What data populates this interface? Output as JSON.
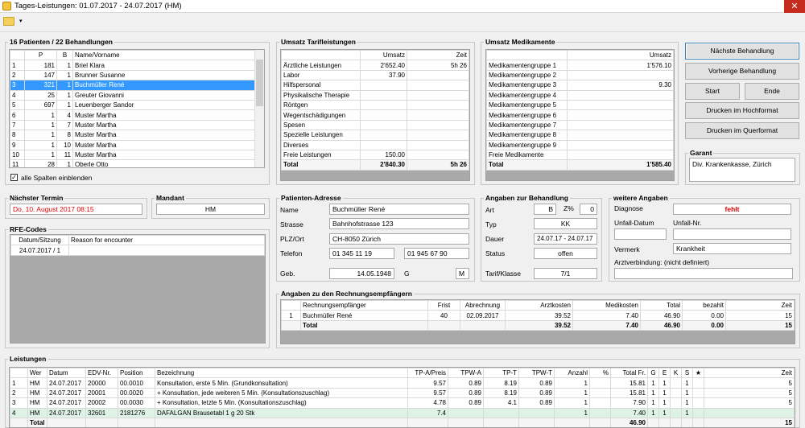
{
  "window": {
    "title": "Tages-Leistungen: 01.07.2017 - 24.07.2017 (HM)",
    "close": "✕"
  },
  "toolbar": {
    "dropdown": "▾"
  },
  "patients": {
    "title": "16 Patienten / 22 Behandlungen",
    "headers": [
      "",
      "P",
      "B",
      "Name/Vorname"
    ],
    "rows": [
      [
        "1",
        "181",
        "1",
        "Briel Klara"
      ],
      [
        "2",
        "147",
        "1",
        "Brunner Susanne"
      ],
      [
        "3",
        "321",
        "1",
        "Buchmüller René"
      ],
      [
        "4",
        "25",
        "1",
        "Greuter Giovanni"
      ],
      [
        "5",
        "697",
        "1",
        "Leuenberger Sandor"
      ],
      [
        "6",
        "1",
        "4",
        "Muster Martha"
      ],
      [
        "7",
        "1",
        "7",
        "Muster Martha"
      ],
      [
        "8",
        "1",
        "8",
        "Muster Martha"
      ],
      [
        "9",
        "1",
        "10",
        "Muster Martha"
      ],
      [
        "10",
        "1",
        "11",
        "Muster Martha"
      ],
      [
        "11",
        "28",
        "1",
        "Oberle Otto"
      ]
    ],
    "selected_index": 2,
    "show_all_label": "alle Spalten einblenden",
    "show_all_checked": "✓"
  },
  "umsatz_tarif": {
    "title": "Umsatz Tarifleistungen",
    "headers": [
      "",
      "Umsatz",
      "Zeit"
    ],
    "rows": [
      [
        "Ärztliche Leistungen",
        "2'652.40",
        "5h 26"
      ],
      [
        "Labor",
        "37.90",
        ""
      ],
      [
        "Hilfspersonal",
        "",
        ""
      ],
      [
        "Physikalische Therapie",
        "",
        ""
      ],
      [
        "Röntgen",
        "",
        ""
      ],
      [
        "Wegentschädigungen",
        "",
        ""
      ],
      [
        "Spesen",
        "",
        ""
      ],
      [
        "Spezielle Leistungen",
        "",
        ""
      ],
      [
        "Diverses",
        "",
        ""
      ],
      [
        "Freie Leistungen",
        "150.00",
        ""
      ]
    ],
    "total": [
      "Total",
      "2'840.30",
      "5h 26"
    ]
  },
  "umsatz_med": {
    "title": "Umsatz Medikamente",
    "headers": [
      "",
      "Umsatz"
    ],
    "rows": [
      [
        "Medikamentengruppe 1",
        "1'576.10"
      ],
      [
        "Medikamentengruppe 2",
        ""
      ],
      [
        "Medikamentengruppe 3",
        "9.30"
      ],
      [
        "Medikamentengruppe 4",
        ""
      ],
      [
        "Medikamentengruppe 5",
        ""
      ],
      [
        "Medikamentengruppe 6",
        ""
      ],
      [
        "Medikamentengruppe 7",
        ""
      ],
      [
        "Medikamentengruppe 8",
        ""
      ],
      [
        "Medikamentengruppe 9",
        ""
      ],
      [
        "Freie Medikamente",
        ""
      ]
    ],
    "total": [
      "Total",
      "1'585.40"
    ]
  },
  "buttons": {
    "next": "Nächste Behandlung",
    "prev": "Vorherige Behandlung",
    "start": "Start",
    "end": "Ende",
    "print_portrait": "Drucken im Hochformat",
    "print_landscape": "Drucken im Querformat"
  },
  "garant": {
    "title": "Garant",
    "value": "Div. Krankenkasse, Zürich"
  },
  "next_appointment": {
    "title": "Nächster Termin",
    "value": "Do, 10. August 2017 08:15"
  },
  "mandant": {
    "title": "Mandant",
    "value": "HM"
  },
  "rfe": {
    "title": "RFE-Codes",
    "headers": [
      "Datum/Sitzung",
      "Reason for encounter"
    ],
    "rows": [
      [
        "24.07.2017 / 1",
        ""
      ]
    ]
  },
  "address": {
    "title": "Patienten-Adresse",
    "name_label": "Name",
    "name": "Buchmüller René",
    "street_label": "Strasse",
    "street": "Bahnhofstrasse 123",
    "city_label": "PLZ/Ort",
    "city": "CH-8050 Zürich",
    "phone_label": "Telefon",
    "phone1": "01 345 11 19",
    "phone2": "01 945 67 90",
    "birth_label": "Geb.",
    "birth": "14.05.1948",
    "sex_label": "G",
    "sex": "M"
  },
  "treatment": {
    "title": "Angaben zur Behandlung",
    "art_label": "Art",
    "art": "B",
    "z_label": "Z%",
    "z": "0",
    "typ_label": "Typ",
    "typ": "KK",
    "dauer_label": "Dauer",
    "dauer": "24.07.17 - 24.07.17",
    "status_label": "Status",
    "status": "offen",
    "tarif_label": "Tarif/Klasse",
    "tarif": "7/1"
  },
  "further": {
    "title": "weitere Angaben",
    "diag_label": "Diagnose",
    "diag": "fehlt",
    "unfall_datum_label": "Unfall-Datum",
    "unfall_nr_label": "Unfall-Nr.",
    "vermerk_label": "Vermerk",
    "vermerk": "Krankheit",
    "arzt_label": "Arztverbindung: (nicht definiert)"
  },
  "recipients": {
    "title": "Angaben zu den Rechnungsempfängern",
    "headers": [
      "",
      "Rechnungsempfänger",
      "Frist",
      "Abrechnung",
      "Arztkosten",
      "Medikosten",
      "Total",
      "bezahlt",
      "Zeit"
    ],
    "rows": [
      [
        "1",
        "Buchmüller René",
        "40",
        "02.09.2017",
        "39.52",
        "7.40",
        "46.90",
        "0.00",
        "15"
      ]
    ],
    "total": [
      "",
      "Total",
      "",
      "",
      "39.52",
      "7.40",
      "46.90",
      "0.00",
      "15"
    ]
  },
  "services": {
    "title": "Leistungen",
    "headers": [
      "",
      "Wer",
      "Datum",
      "EDV-Nr.",
      "Position",
      "Bezeichnung",
      "TP-A/Preis",
      "TPW-A",
      "TP-T",
      "TPW-T",
      "Anzahl",
      "%",
      "Total Fr.",
      "G",
      "E",
      "K",
      "S",
      "★",
      "Zeit"
    ],
    "rows": [
      [
        "1",
        "HM",
        "24.07.2017",
        "20000",
        "00.0010",
        "Konsultation, erste 5 Min. (Grundkonsultation)",
        "9.57",
        "0.89",
        "8.19",
        "0.89",
        "1",
        "",
        "15.81",
        "1",
        "1",
        "",
        "1",
        "",
        "5"
      ],
      [
        "2",
        "HM",
        "24.07.2017",
        "20001",
        "00.0020",
        "+ Konsultation, jede weiteren 5 Min. (Konsultationszuschlag)",
        "9.57",
        "0.89",
        "8.19",
        "0.89",
        "1",
        "",
        "15.81",
        "1",
        "1",
        "",
        "1",
        "",
        "5"
      ],
      [
        "3",
        "HM",
        "24.07.2017",
        "20002",
        "00.0030",
        "+ Konsultation, letzte 5 Min. (Konsultationszuschlag)",
        "4.78",
        "0.89",
        "4.1",
        "0.89",
        "1",
        "",
        "7.90",
        "1",
        "1",
        "",
        "1",
        "",
        "5"
      ],
      [
        "4",
        "HM",
        "24.07.2017",
        "32601",
        "2181276",
        "DAFALGAN Brausetabl 1 g 20 Stk",
        "7.4",
        "",
        "",
        "",
        "1",
        "",
        "7.40",
        "1",
        "1",
        "",
        "1",
        "",
        ""
      ]
    ],
    "total": [
      "",
      "Total",
      "",
      "",
      "",
      "",
      "",
      "",
      "",
      "",
      "",
      "",
      "46.90",
      "",
      "",
      "",
      "",
      "",
      "15"
    ]
  },
  "colors": {
    "selection": "#3399ff",
    "red_text": "#e00000",
    "accent": "#3c7fb1"
  }
}
